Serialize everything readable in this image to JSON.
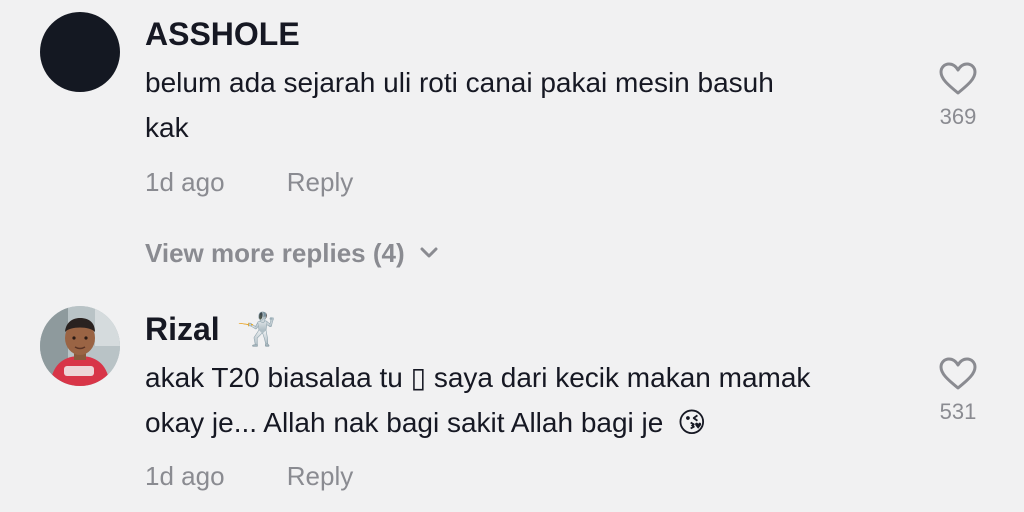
{
  "comments": [
    {
      "username": "ASSHOLE",
      "text_line1": "belum ada sejarah uli roti canai pakai mesin basuh",
      "text_line2": "kak",
      "time": "1d ago",
      "reply_label": "Reply",
      "like_count": "369",
      "view_more_label": "View more replies (4)"
    },
    {
      "username": "Rizal",
      "username_emoji": "🤺",
      "text_line1": "akak T20 biasalaa tu ▯ saya dari kecik makan mamak",
      "text_line2": "okay je... Allah nak bagi sakit Allah bagi je",
      "text_emoji": "😘",
      "time": "1d ago",
      "reply_label": "Reply",
      "like_count": "531"
    }
  ],
  "colors": {
    "background": "#f1f1f2",
    "text": "#161823",
    "muted": "#8a8b91",
    "avatar_dark": "#141822"
  },
  "icons": [
    "heart-outline-icon",
    "chevron-down-icon",
    "fencer-emoji",
    "kiss-emoji"
  ]
}
